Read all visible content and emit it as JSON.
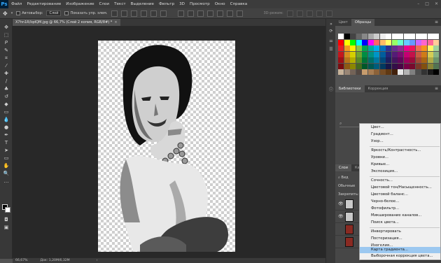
{
  "app": {
    "logo": "Ps"
  },
  "menubar": {
    "items": [
      "Файл",
      "Редактирование",
      "Изображение",
      "Слои",
      "Текст",
      "Выделение",
      "Фильтр",
      "3D",
      "Просмотр",
      "Окно",
      "Справка"
    ]
  },
  "options": {
    "autoselect_label": "Автовыбор:",
    "autoselect_value": "Слой",
    "show_controls_label": "Показать упр. элем.",
    "mode_3d_label": "3D-режим:"
  },
  "document": {
    "tab_title": "X7hn1R/IqdQM.jpg @ 66,7% (Слой 2 копия, RGB/8#) *",
    "close_glyph": "×"
  },
  "status": {
    "zoom": "66,67%",
    "doc_size": "Док: 1,20М/6,32М"
  },
  "panels": {
    "color_tab": "Цвет",
    "swatches_tab": "Образцы",
    "libraries_tab": "Библиотеки",
    "adjustments_tab": "Коррекция",
    "layers_tab": "Слои",
    "layers_tab_cut": "Кан",
    "kind_label": "Вид",
    "blend_label": "Обычные",
    "lock_label": "Закрепить:",
    "menu_glyph": "≡"
  },
  "swatch_colors": [
    "#ffffff",
    "#000000",
    "#444444",
    "#666666",
    "#888888",
    "#aaaaaa",
    "#cccccc",
    "#eeeeee",
    "#ffffff",
    "#ffffff",
    "#ffffff",
    "#ffffff",
    "#ffffff",
    "#ffffff",
    "#ffffff",
    "#ffffff",
    "#ffffff",
    "#ff0000",
    "#ffff00",
    "#00ff00",
    "#00ffff",
    "#0000ff",
    "#ff00ff",
    "#ff6666",
    "#ffbb66",
    "#ffff66",
    "#99ff66",
    "#66ffcc",
    "#66ccff",
    "#6699ff",
    "#cc66ff",
    "#ff66cc",
    "#ff6699",
    "#ffcc99",
    "#e61e25",
    "#f39a1e",
    "#fff100",
    "#8dc63f",
    "#00a651",
    "#00a99d",
    "#00aeef",
    "#0072bc",
    "#2e3192",
    "#662d91",
    "#92278f",
    "#ec008c",
    "#ed145b",
    "#f26c4f",
    "#f7941d",
    "#fff568",
    "#a3d39c",
    "#c4161c",
    "#d68b20",
    "#d5d000",
    "#6fa42f",
    "#008d43",
    "#008f83",
    "#0095c7",
    "#005e9c",
    "#262678",
    "#541c76",
    "#790e71",
    "#c40073",
    "#c4124a",
    "#c75b42",
    "#cf7c18",
    "#d5cd55",
    "#87b182",
    "#9e1016",
    "#b5741a",
    "#b3ae00",
    "#5a8a25",
    "#007236",
    "#007068",
    "#0078a0",
    "#004a7c",
    "#1e1f60",
    "#43155e",
    "#61075a",
    "#9d005c",
    "#9c0d3b",
    "#a24a35",
    "#a96614",
    "#b0aa46",
    "#6c946b",
    "#7a0c10",
    "#8e5a14",
    "#8b8700",
    "#456b1c",
    "#00572a",
    "#005750",
    "#005c7b",
    "#00395f",
    "#171749",
    "#330f48",
    "#4a0545",
    "#780047",
    "#780a2d",
    "#7c3828",
    "#82500f",
    "#888336",
    "#527352",
    "#c7b299",
    "#998675",
    "#736357",
    "#534741",
    "#c69c6d",
    "#a67c52",
    "#8c6239",
    "#754c24",
    "#603913",
    "#42210b",
    "#e6e6e6",
    "#b3b3b3",
    "#808080",
    "#4d4d4d",
    "#333333",
    "#1a1a1a",
    "#000000"
  ],
  "adjust_menu": {
    "items": [
      "Цвет...",
      "Градиент...",
      "Узор...",
      "Яркость/Контрастность...",
      "Уровни...",
      "Кривые...",
      "Экспозиция...",
      "Сочность...",
      "Цветовой тон/Насыщенность...",
      "Цветовой баланс...",
      "Черно-белое...",
      "Фотофильтр...",
      "Микширование каналов...",
      "Поиск цвета...",
      "Инвертировать",
      "Постеризация...",
      "Изогелия...",
      "Карта градиента...",
      "Выборочная коррекция цвета..."
    ],
    "highlighted": "Карта градиента..."
  }
}
